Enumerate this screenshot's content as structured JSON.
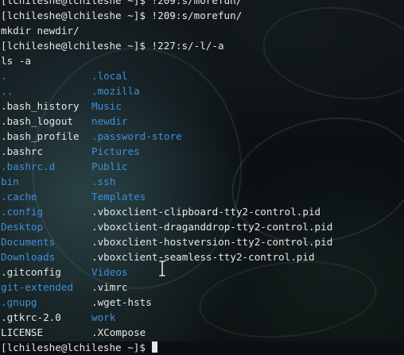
{
  "colors": {
    "text": "#e6e6e6",
    "directory": "#3e8fd8"
  },
  "terminal": {
    "lines": [
      {
        "kind": "plain",
        "text": "[lchileshe@lchileshe ~]$ !209:s/morefun/"
      },
      {
        "kind": "plain",
        "text": "[lchileshe@lchileshe ~]$ !209:s/morefun/"
      },
      {
        "kind": "plain",
        "text": "mkdir newdir/"
      },
      {
        "kind": "plain",
        "text": "[lchileshe@lchileshe ~]$ !227:s/-l/-a"
      },
      {
        "kind": "plain",
        "text": "ls -a"
      },
      {
        "kind": "pair",
        "left": ".",
        "left_type": "dir",
        "right": ".local",
        "right_type": "dir"
      },
      {
        "kind": "pair",
        "left": "..",
        "left_type": "dir",
        "right": ".mozilla",
        "right_type": "dir"
      },
      {
        "kind": "pair",
        "left": ".bash_history",
        "left_type": "file",
        "right": "Music",
        "right_type": "dir"
      },
      {
        "kind": "pair",
        "left": ".bash_logout",
        "left_type": "file",
        "right": "newdir",
        "right_type": "dir"
      },
      {
        "kind": "pair",
        "left": ".bash_profile",
        "left_type": "file",
        "right": ".password-store",
        "right_type": "dir"
      },
      {
        "kind": "pair",
        "left": ".bashrc",
        "left_type": "file",
        "right": "Pictures",
        "right_type": "dir"
      },
      {
        "kind": "pair",
        "left": ".bashrc.d",
        "left_type": "dir",
        "right": "Public",
        "right_type": "dir"
      },
      {
        "kind": "pair",
        "left": "bin",
        "left_type": "dir",
        "right": ".ssh",
        "right_type": "dir"
      },
      {
        "kind": "pair",
        "left": ".cache",
        "left_type": "dir",
        "right": "Templates",
        "right_type": "dir"
      },
      {
        "kind": "pair",
        "left": ".config",
        "left_type": "dir",
        "right": ".vboxclient-clipboard-tty2-control.pid",
        "right_type": "file"
      },
      {
        "kind": "pair",
        "left": "Desktop",
        "left_type": "dir",
        "right": ".vboxclient-draganddrop-tty2-control.pid",
        "right_type": "file"
      },
      {
        "kind": "pair",
        "left": "Documents",
        "left_type": "dir",
        "right": ".vboxclient-hostversion-tty2-control.pid",
        "right_type": "file"
      },
      {
        "kind": "pair",
        "left": "Downloads",
        "left_type": "dir",
        "right": ".vboxclient-seamless-tty2-control.pid",
        "right_type": "file"
      },
      {
        "kind": "pair",
        "left": ".gitconfig",
        "left_type": "file",
        "right": "Videos",
        "right_type": "dir"
      },
      {
        "kind": "pair",
        "left": "git-extended",
        "left_type": "dir",
        "right": ".vimrc",
        "right_type": "file"
      },
      {
        "kind": "pair",
        "left": ".gnupg",
        "left_type": "dir",
        "right": ".wget-hsts",
        "right_type": "file"
      },
      {
        "kind": "pair",
        "left": ".gtkrc-2.0",
        "left_type": "file",
        "right": "work",
        "right_type": "dir"
      },
      {
        "kind": "pair",
        "left": "LICENSE",
        "left_type": "file",
        "right": ".XCompose",
        "right_type": "file"
      },
      {
        "kind": "prompt",
        "text": "[lchileshe@lchileshe ~]$ "
      }
    ]
  },
  "icons": {
    "text_cursor": "ibeam-cursor-icon",
    "block_cursor": "block-cursor-icon"
  }
}
